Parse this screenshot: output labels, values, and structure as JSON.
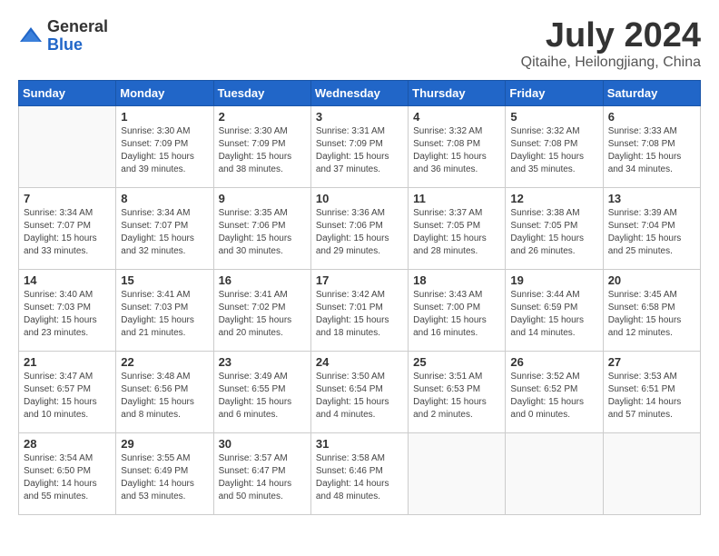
{
  "header": {
    "logo_general": "General",
    "logo_blue": "Blue",
    "title": "July 2024",
    "location": "Qitaihe, Heilongjiang, China"
  },
  "days_of_week": [
    "Sunday",
    "Monday",
    "Tuesday",
    "Wednesday",
    "Thursday",
    "Friday",
    "Saturday"
  ],
  "weeks": [
    [
      {
        "day": "",
        "info": ""
      },
      {
        "day": "1",
        "info": "Sunrise: 3:30 AM\nSunset: 7:09 PM\nDaylight: 15 hours\nand 39 minutes."
      },
      {
        "day": "2",
        "info": "Sunrise: 3:30 AM\nSunset: 7:09 PM\nDaylight: 15 hours\nand 38 minutes."
      },
      {
        "day": "3",
        "info": "Sunrise: 3:31 AM\nSunset: 7:09 PM\nDaylight: 15 hours\nand 37 minutes."
      },
      {
        "day": "4",
        "info": "Sunrise: 3:32 AM\nSunset: 7:08 PM\nDaylight: 15 hours\nand 36 minutes."
      },
      {
        "day": "5",
        "info": "Sunrise: 3:32 AM\nSunset: 7:08 PM\nDaylight: 15 hours\nand 35 minutes."
      },
      {
        "day": "6",
        "info": "Sunrise: 3:33 AM\nSunset: 7:08 PM\nDaylight: 15 hours\nand 34 minutes."
      }
    ],
    [
      {
        "day": "7",
        "info": "Sunrise: 3:34 AM\nSunset: 7:07 PM\nDaylight: 15 hours\nand 33 minutes."
      },
      {
        "day": "8",
        "info": "Sunrise: 3:34 AM\nSunset: 7:07 PM\nDaylight: 15 hours\nand 32 minutes."
      },
      {
        "day": "9",
        "info": "Sunrise: 3:35 AM\nSunset: 7:06 PM\nDaylight: 15 hours\nand 30 minutes."
      },
      {
        "day": "10",
        "info": "Sunrise: 3:36 AM\nSunset: 7:06 PM\nDaylight: 15 hours\nand 29 minutes."
      },
      {
        "day": "11",
        "info": "Sunrise: 3:37 AM\nSunset: 7:05 PM\nDaylight: 15 hours\nand 28 minutes."
      },
      {
        "day": "12",
        "info": "Sunrise: 3:38 AM\nSunset: 7:05 PM\nDaylight: 15 hours\nand 26 minutes."
      },
      {
        "day": "13",
        "info": "Sunrise: 3:39 AM\nSunset: 7:04 PM\nDaylight: 15 hours\nand 25 minutes."
      }
    ],
    [
      {
        "day": "14",
        "info": "Sunrise: 3:40 AM\nSunset: 7:03 PM\nDaylight: 15 hours\nand 23 minutes."
      },
      {
        "day": "15",
        "info": "Sunrise: 3:41 AM\nSunset: 7:03 PM\nDaylight: 15 hours\nand 21 minutes."
      },
      {
        "day": "16",
        "info": "Sunrise: 3:41 AM\nSunset: 7:02 PM\nDaylight: 15 hours\nand 20 minutes."
      },
      {
        "day": "17",
        "info": "Sunrise: 3:42 AM\nSunset: 7:01 PM\nDaylight: 15 hours\nand 18 minutes."
      },
      {
        "day": "18",
        "info": "Sunrise: 3:43 AM\nSunset: 7:00 PM\nDaylight: 15 hours\nand 16 minutes."
      },
      {
        "day": "19",
        "info": "Sunrise: 3:44 AM\nSunset: 6:59 PM\nDaylight: 15 hours\nand 14 minutes."
      },
      {
        "day": "20",
        "info": "Sunrise: 3:45 AM\nSunset: 6:58 PM\nDaylight: 15 hours\nand 12 minutes."
      }
    ],
    [
      {
        "day": "21",
        "info": "Sunrise: 3:47 AM\nSunset: 6:57 PM\nDaylight: 15 hours\nand 10 minutes."
      },
      {
        "day": "22",
        "info": "Sunrise: 3:48 AM\nSunset: 6:56 PM\nDaylight: 15 hours\nand 8 minutes."
      },
      {
        "day": "23",
        "info": "Sunrise: 3:49 AM\nSunset: 6:55 PM\nDaylight: 15 hours\nand 6 minutes."
      },
      {
        "day": "24",
        "info": "Sunrise: 3:50 AM\nSunset: 6:54 PM\nDaylight: 15 hours\nand 4 minutes."
      },
      {
        "day": "25",
        "info": "Sunrise: 3:51 AM\nSunset: 6:53 PM\nDaylight: 15 hours\nand 2 minutes."
      },
      {
        "day": "26",
        "info": "Sunrise: 3:52 AM\nSunset: 6:52 PM\nDaylight: 15 hours\nand 0 minutes."
      },
      {
        "day": "27",
        "info": "Sunrise: 3:53 AM\nSunset: 6:51 PM\nDaylight: 14 hours\nand 57 minutes."
      }
    ],
    [
      {
        "day": "28",
        "info": "Sunrise: 3:54 AM\nSunset: 6:50 PM\nDaylight: 14 hours\nand 55 minutes."
      },
      {
        "day": "29",
        "info": "Sunrise: 3:55 AM\nSunset: 6:49 PM\nDaylight: 14 hours\nand 53 minutes."
      },
      {
        "day": "30",
        "info": "Sunrise: 3:57 AM\nSunset: 6:47 PM\nDaylight: 14 hours\nand 50 minutes."
      },
      {
        "day": "31",
        "info": "Sunrise: 3:58 AM\nSunset: 6:46 PM\nDaylight: 14 hours\nand 48 minutes."
      },
      {
        "day": "",
        "info": ""
      },
      {
        "day": "",
        "info": ""
      },
      {
        "day": "",
        "info": ""
      }
    ]
  ]
}
